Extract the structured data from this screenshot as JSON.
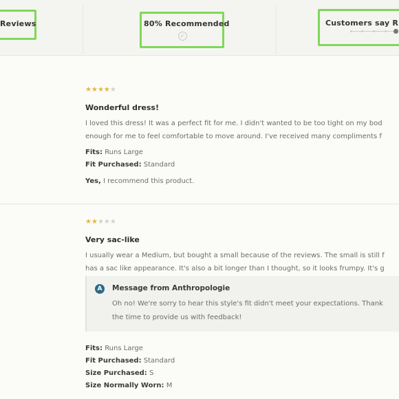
{
  "summary": {
    "reviews_label": "Reviews",
    "recommended_label": "80% Recommended",
    "fit_label": "Customers say Runs"
  },
  "reviews": [
    {
      "rating": 4,
      "title": "Wonderful dress!",
      "body_line1": "I loved this dress! It was a perfect fit for me. I didn't wanted to be too tight on my bod",
      "body_line2": "enough for me to feel comfortable to move around. I've received many compliments f",
      "fits_label": "Fits:",
      "fits_value": "Runs Large",
      "fit_purchased_label": "Fit Purchased:",
      "fit_purchased_value": "Standard",
      "recommend_yes": "Yes,",
      "recommend_text": "I recommend this product."
    },
    {
      "rating": 2,
      "title": "Very sac-like",
      "body_line1": "I usually wear a Medium, but bought a small because of the reviews. The small is still f",
      "body_line2": "has a sac like appearance. It's also a bit longer than I thought, so it looks frumpy. It's g",
      "reply": {
        "avatar_letter": "A",
        "title": "Message from Anthropologie",
        "line1": "Oh no! We're sorry to hear this style's fit didn't meet your expectations. Thank",
        "line2": "the time to provide us with feedback!"
      },
      "fits_label": "Fits:",
      "fits_value": "Runs Large",
      "fit_purchased_label": "Fit Purchased:",
      "fit_purchased_value": "Standard",
      "size_purchased_label": "Size Purchased:",
      "size_purchased_value": "S",
      "size_normally_label": "Size Normally Worn:",
      "size_normally_value": "M"
    }
  ],
  "colors": {
    "star_on": "#e3b542",
    "star_off": "#d2d2cd",
    "highlight": "#7ed957",
    "avatar": "#2b6a86"
  }
}
